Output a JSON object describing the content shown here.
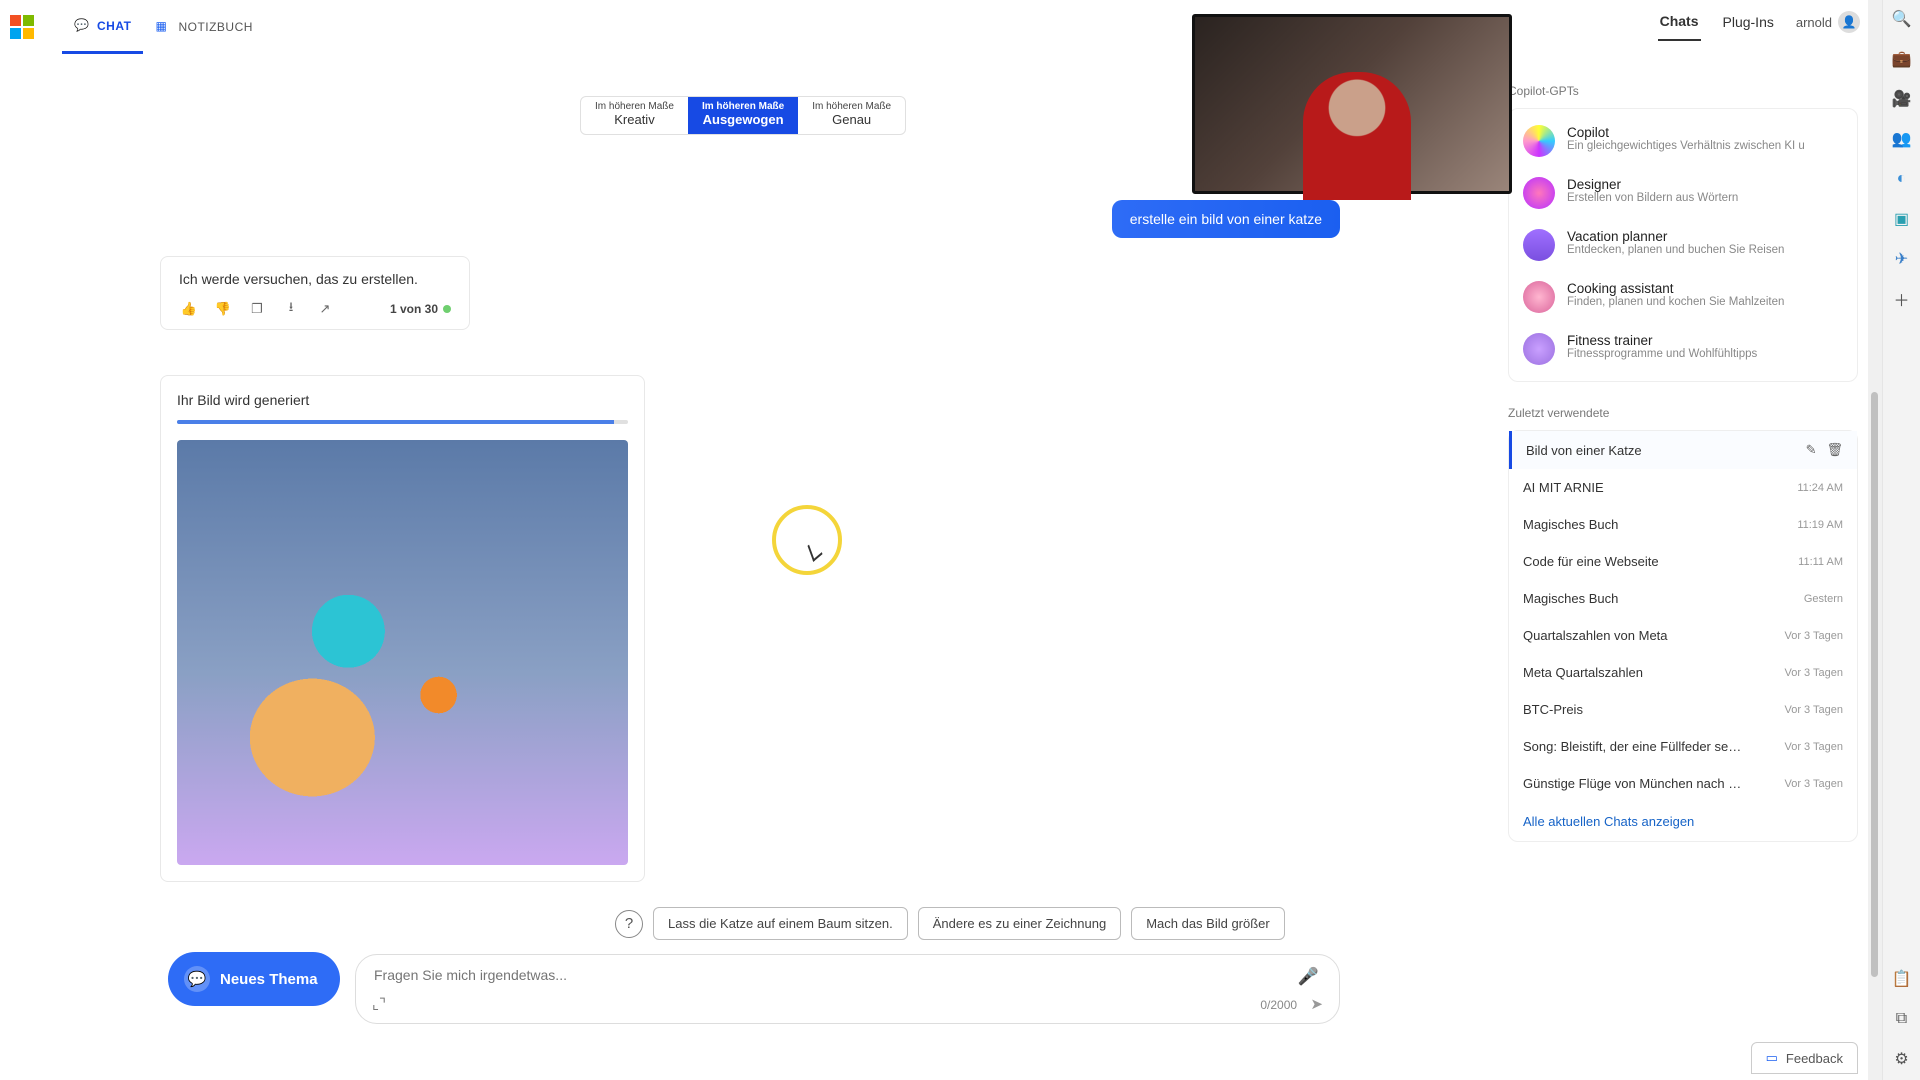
{
  "header": {
    "tab_chat": "CHAT",
    "tab_notebook": "NOTIZBUCH",
    "rtab_chats": "Chats",
    "rtab_plugins": "Plug-Ins",
    "user": "arnold"
  },
  "style": {
    "l1": "Im höheren Maße",
    "creative": "Kreativ",
    "balanced": "Ausgewogen",
    "precise": "Genau"
  },
  "chat": {
    "user_message": "erstelle ein bild von einer katze",
    "bot_reply": "Ich werde versuchen, das zu erstellen.",
    "counter": "1 von 30",
    "gen_title": "Ihr Bild wird generiert"
  },
  "suggestions": {
    "s1": "Lass die Katze auf einem Baum sitzen.",
    "s2": "Ändere es zu einer Zeichnung",
    "s3": "Mach das Bild größer"
  },
  "compose": {
    "new_topic": "Neues Thema",
    "placeholder": "Fragen Sie mich irgendetwas...",
    "counter": "0/2000"
  },
  "gpts_title": "Copilot-GPTs",
  "gpts": [
    {
      "name": "Copilot",
      "desc": "Ein gleichgewichtiges Verhältnis zwischen KI u"
    },
    {
      "name": "Designer",
      "desc": "Erstellen von Bildern aus Wörtern"
    },
    {
      "name": "Vacation planner",
      "desc": "Entdecken, planen und buchen Sie Reisen"
    },
    {
      "name": "Cooking assistant",
      "desc": "Finden, planen und kochen Sie Mahlzeiten"
    },
    {
      "name": "Fitness trainer",
      "desc": "Fitnessprogramme und Wohlfühltipps"
    }
  ],
  "recents_title": "Zuletzt verwendete",
  "recents": [
    {
      "title": "Bild von einer Katze",
      "time": "",
      "active": true
    },
    {
      "title": "AI MIT ARNIE",
      "time": "11:24 AM"
    },
    {
      "title": "Magisches Buch",
      "time": "11:19 AM"
    },
    {
      "title": "Code für eine Webseite",
      "time": "11:11 AM"
    },
    {
      "title": "Magisches Buch",
      "time": "Gestern"
    },
    {
      "title": "Quartalszahlen von Meta",
      "time": "Vor 3 Tagen"
    },
    {
      "title": "Meta Quartalszahlen",
      "time": "Vor 3 Tagen"
    },
    {
      "title": "BTC-Preis",
      "time": "Vor 3 Tagen"
    },
    {
      "title": "Song: Bleistift, der eine Füllfeder sein m",
      "time": "Vor 3 Tagen"
    },
    {
      "title": "Günstige Flüge von München nach Fra",
      "time": "Vor 3 Tagen"
    }
  ],
  "show_all": "Alle aktuellen Chats anzeigen",
  "feedback": "Feedback"
}
